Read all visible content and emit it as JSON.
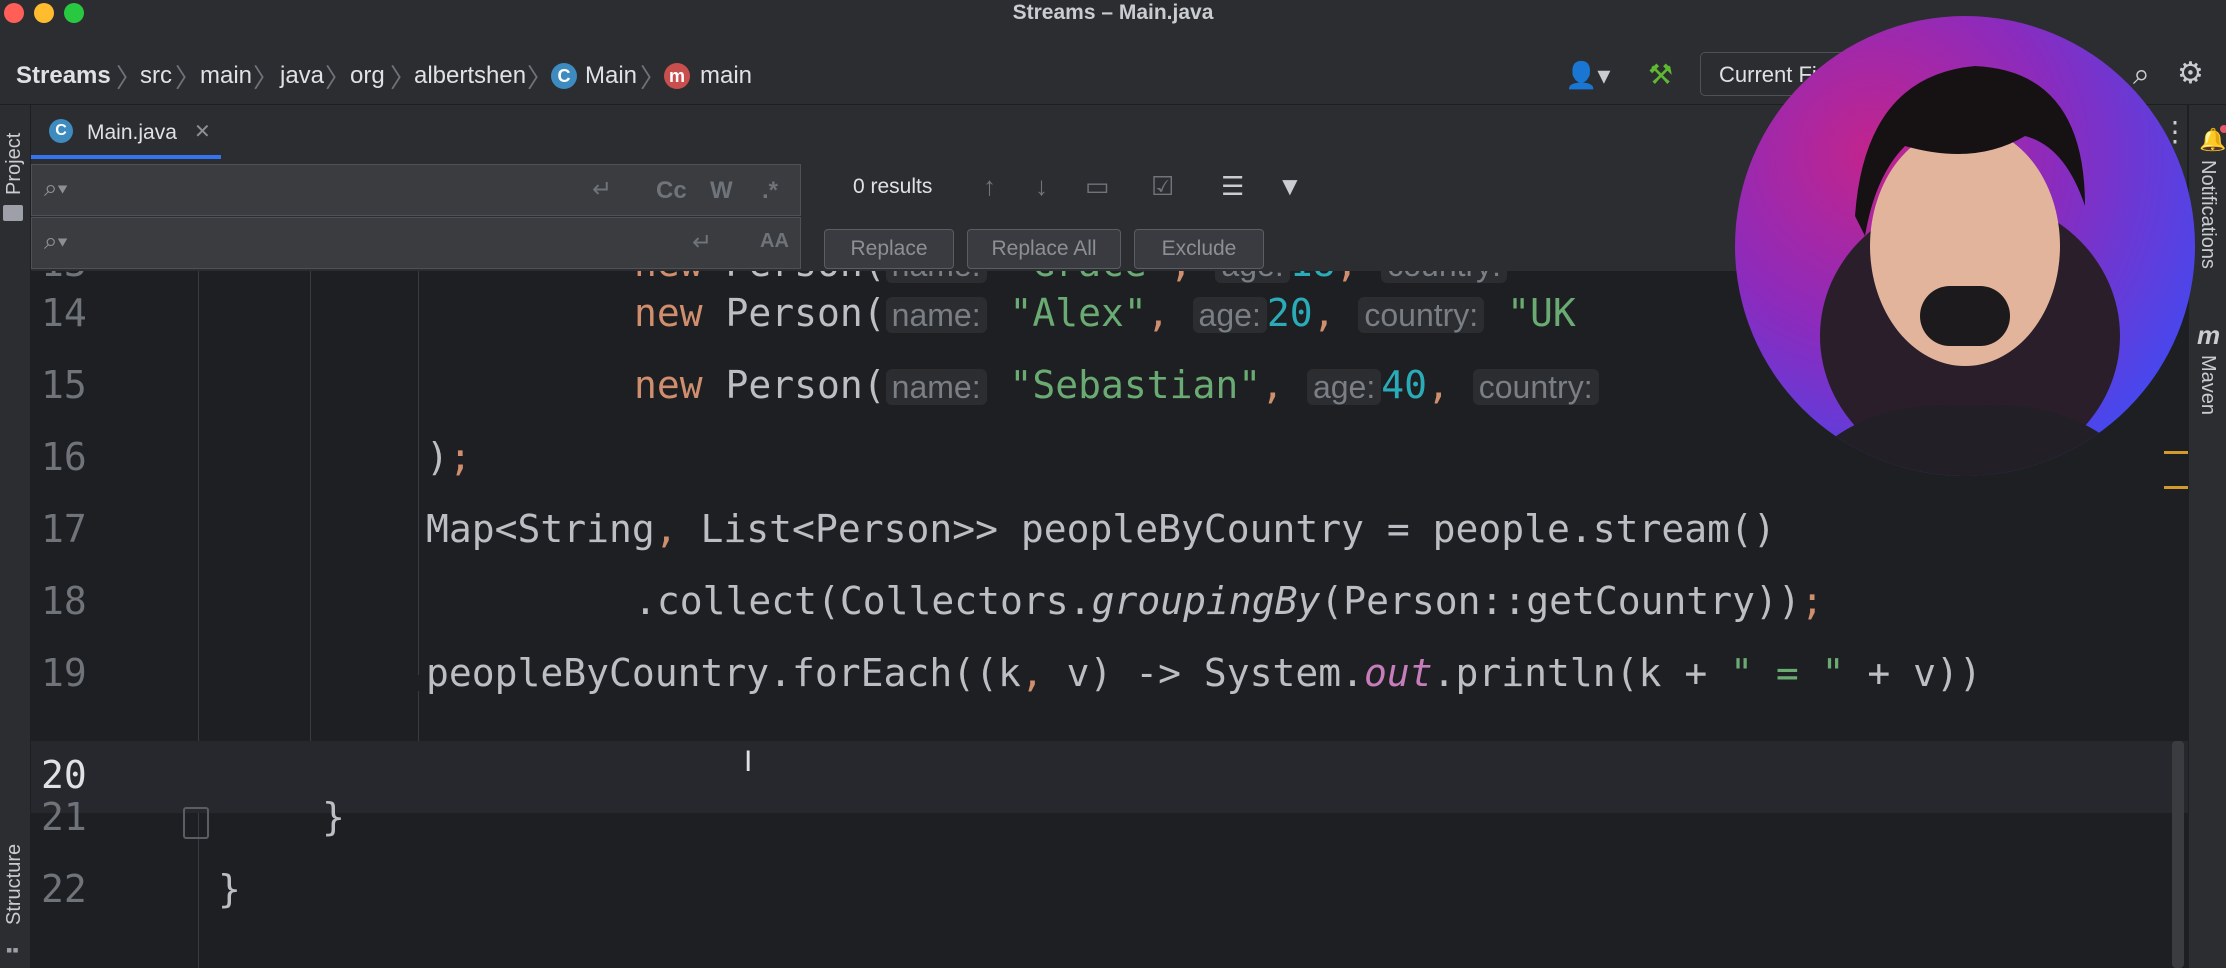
{
  "window": {
    "title": "Streams – Main.java"
  },
  "breadcrumb": {
    "items": [
      "Streams",
      "src",
      "main",
      "java",
      "org",
      "albertshen",
      "Main",
      "main"
    ]
  },
  "toolbar": {
    "run_config": "Current Fi"
  },
  "left_strip": {
    "project": "Project",
    "structure": "Structure"
  },
  "right_strip": {
    "notifications": "Notifications",
    "maven": "Maven"
  },
  "tab": {
    "label": "Main.java"
  },
  "find": {
    "results": "0 results",
    "replace": "Replace",
    "replace_all": "Replace All",
    "exclude": "Exclude",
    "opt_case": "Cc",
    "opt_word": "W",
    "opt_regex": ".*",
    "opt_preserve": "AA"
  },
  "editor": {
    "line_numbers": [
      "13",
      "14",
      "15",
      "16",
      "17",
      "18",
      "19",
      "20",
      "21",
      "22"
    ],
    "lines": [
      {
        "p1": "new ",
        "p2": "Person(",
        "h1": "name:",
        "v1": "\"Grace\"",
        "h2": "age:",
        "v2": "18",
        "h3": "country:",
        "v3": "\""
      },
      {
        "p1": "new ",
        "p2": "Person(",
        "h1": "name:",
        "v1": "\"Alex\"",
        "h2": "age:",
        "v2": "20",
        "h3": "country:",
        "v3": "\"UK"
      },
      {
        "p1": "new ",
        "p2": "Person(",
        "h1": "name:",
        "v1": "\"Sebastian\"",
        "h2": "age:",
        "v2": "40",
        "h3": "country:",
        "v3": ""
      },
      {
        "a": ")",
        "b": ";"
      },
      {
        "a": "Map<String",
        "b": ",",
        "c": " List<Person>> peopleByCountry = people.stream()"
      },
      {
        "a": ".collect(Collectors.",
        "b": "groupingBy",
        "c": "(Person::getCountry))",
        "d": ";"
      },
      {
        "a": "peopleByCountry.forEach((k",
        "b": ",",
        "c": " v) -> System.",
        "d": "out",
        "e": ".println(k + ",
        "f": "\" = \"",
        "g": " + v))"
      },
      {},
      {
        "a": "}"
      },
      {
        "a": "}"
      }
    ]
  },
  "colors": {
    "accent": "#3574f0",
    "keyword": "#cf8e6d",
    "string": "#6aab73",
    "number": "#2aacb8",
    "static_field": "#c77dbb"
  }
}
